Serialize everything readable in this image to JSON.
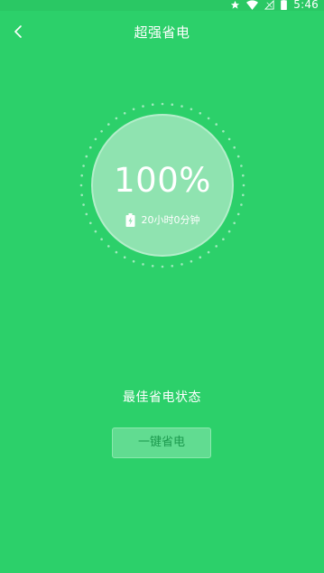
{
  "status_bar": {
    "time": "5:46",
    "icons": [
      "star-icon",
      "wifi-icon",
      "no-signal-icon",
      "battery-icon"
    ]
  },
  "header": {
    "title": "超强省电",
    "back_icon": "chevron-left-icon"
  },
  "battery": {
    "percent": "100%",
    "remaining_time": "20小时0分钟",
    "level": 1.0
  },
  "status_text": "最佳省电状态",
  "action_button": "一键省电",
  "colors": {
    "background": "#2cd06a",
    "circle": "#8fe3b0",
    "button": "#61dc91",
    "button_text": "#1c9a4e"
  }
}
